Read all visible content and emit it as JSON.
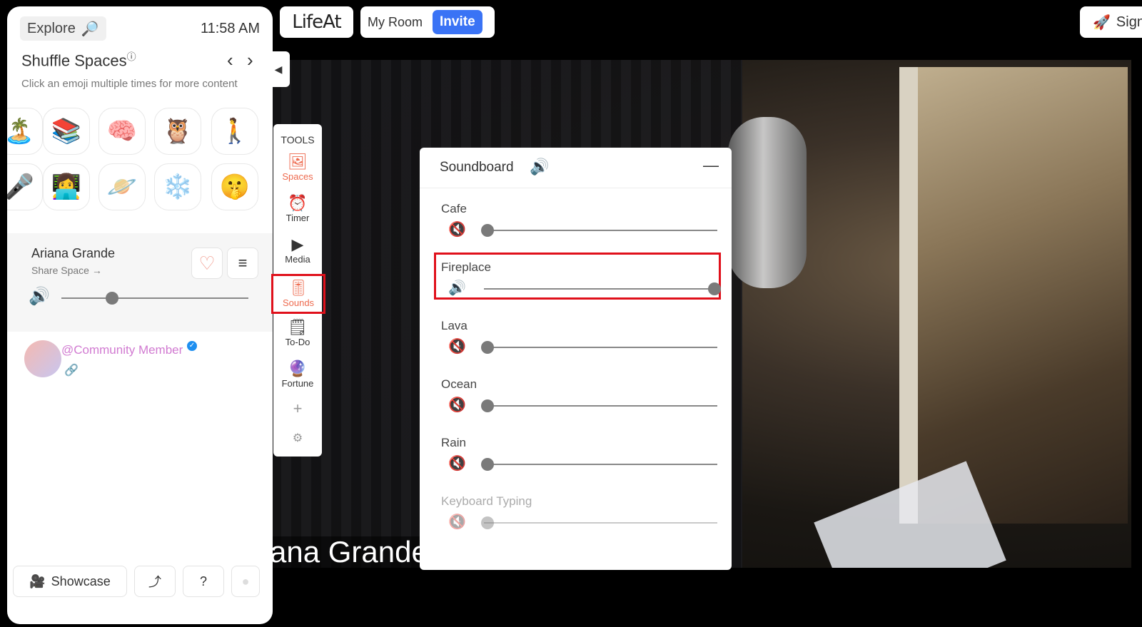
{
  "topbar": {
    "logo": "LifeAt",
    "my_room": "My Room",
    "invite": "Invite",
    "sign": "Sign"
  },
  "left_panel": {
    "explore": "Explore",
    "time": "11:58 AM",
    "shuffle_title": "Shuffle Spaces",
    "hint": "Click an emoji multiple times for more content",
    "emojis_row1": [
      "🏝️",
      "📚",
      "🧠",
      "🦉",
      "🚶"
    ],
    "emojis_row2": [
      "🎤",
      "👩‍💻",
      "🪐",
      "❄️",
      "🤫"
    ],
    "artist": "Ariana Grande",
    "share": "Share Space →",
    "volume_level": 0.27,
    "member": "@Community Member",
    "showcase": "Showcase",
    "help": "?"
  },
  "tools": {
    "label": "TOOLS",
    "items": [
      {
        "label": "Spaces",
        "icon": "image-icon"
      },
      {
        "label": "Timer",
        "icon": "alarm-clock-icon"
      },
      {
        "label": "Media",
        "icon": "media-play-icon"
      },
      {
        "label": "Sounds",
        "icon": "sliders-icon"
      },
      {
        "label": "To-Do",
        "icon": "notes-icon"
      },
      {
        "label": "Fortune",
        "icon": "crystal-ball-icon"
      }
    ],
    "active": "Sounds"
  },
  "soundboard": {
    "title": "Soundboard",
    "sounds": [
      {
        "label": "Cafe",
        "level": 0.0,
        "muted": true
      },
      {
        "label": "Fireplace",
        "level": 1.0,
        "muted": false
      },
      {
        "label": "Lava",
        "level": 0.0,
        "muted": true
      },
      {
        "label": "Ocean",
        "level": 0.0,
        "muted": true
      },
      {
        "label": "Rain",
        "level": 0.0,
        "muted": true
      },
      {
        "label": "Keyboard Typing",
        "level": 0.0,
        "muted": true
      }
    ]
  },
  "caption": "ana Grande",
  "colors": {
    "accent_blue": "#3a73f5",
    "active_tool": "#ee6a4e",
    "highlight_red": "#e0101b"
  }
}
